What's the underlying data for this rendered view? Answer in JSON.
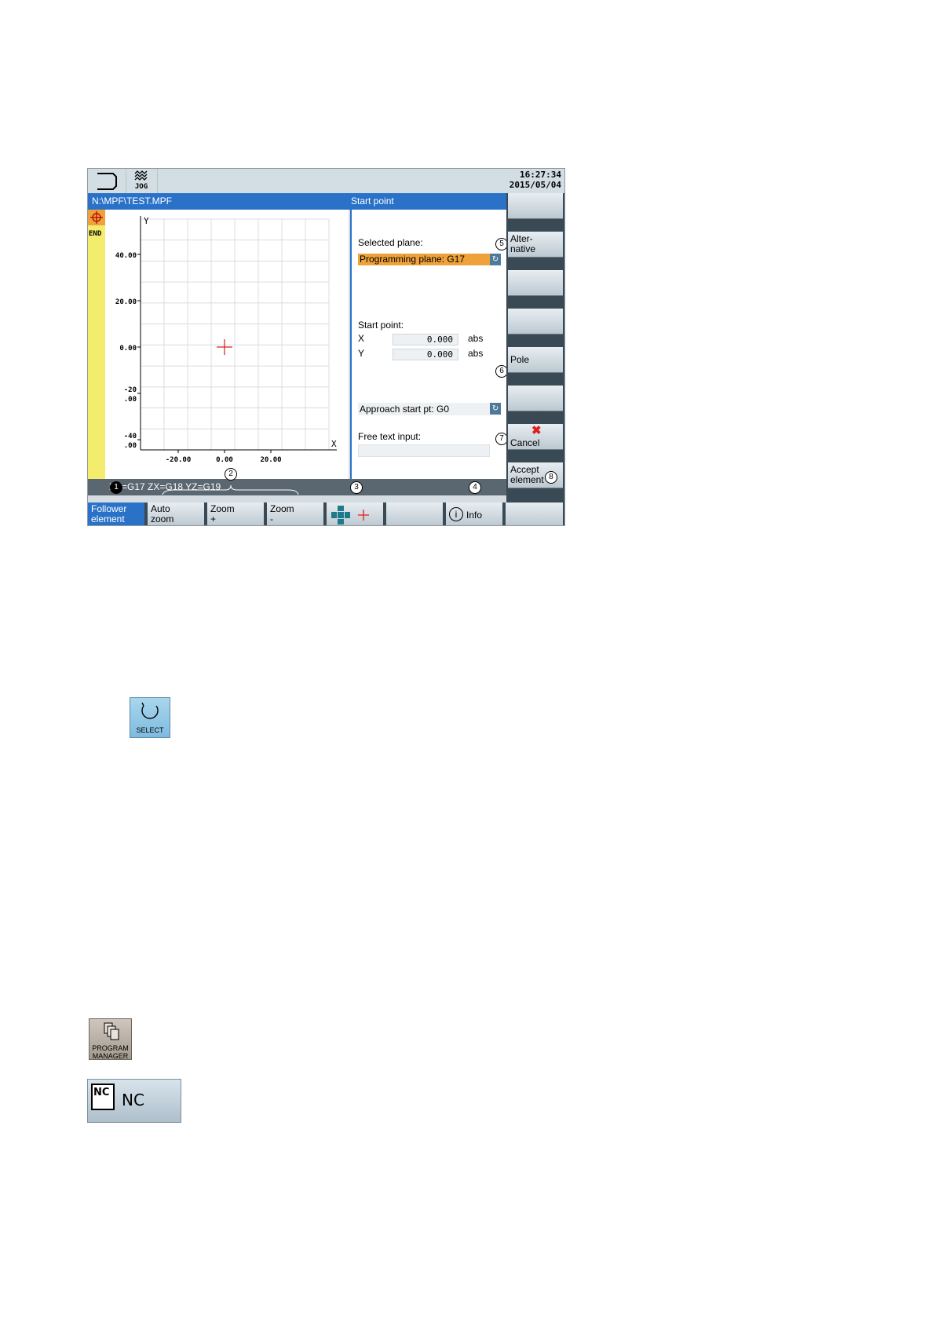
{
  "header": {
    "mode": "JOG",
    "time": "16:27:34",
    "date": "2015/05/04"
  },
  "title": {
    "path": "N:\\MPF\\TEST.MPF",
    "form_name": "Start point"
  },
  "left_strip": {
    "end_label": "END"
  },
  "graphic": {
    "y_axis_label": "Y",
    "x_axis_label": "X",
    "y_ticks": [
      "40.00",
      "20.00",
      "0.00",
      "-20\n.00",
      "-40\n.00"
    ],
    "x_ticks": [
      "-20.00",
      "0.00",
      "20.00"
    ],
    "start_marker": {
      "x": 0.0,
      "y": 0.0
    }
  },
  "form": {
    "selected_plane_label": "Selected plane:",
    "selected_plane_value": "Programming plane: G17",
    "start_point_label": "Start point:",
    "x_label": "X",
    "x_value": "0.000",
    "x_unit": "abs",
    "y_label": "Y",
    "y_value": "0.000",
    "y_unit": "abs",
    "approach_value": "Approach start pt: G0",
    "free_text_label": "Free text input:",
    "free_text_value": ""
  },
  "status": {
    "plane_hint": "XY=G17 ZX=G18 YZ=G19"
  },
  "vertical_softkeys": [
    {
      "label": ""
    },
    {
      "label": "Alter-\nnative"
    },
    {
      "label": ""
    },
    {
      "label": ""
    },
    {
      "label": "Pole"
    },
    {
      "label": ""
    },
    {
      "label": "Cancel"
    },
    {
      "label": "Accept\nelement"
    }
  ],
  "horizontal_softkeys": [
    {
      "label": "Follower\nelement"
    },
    {
      "label": "Auto\nzoom"
    },
    {
      "label": "Zoom\n+"
    },
    {
      "label": "Zoom\n-"
    },
    {
      "label": ""
    },
    {
      "label": ""
    },
    {
      "label": "Info"
    },
    {
      "label": ""
    }
  ],
  "callouts": [
    "1",
    "2",
    "3",
    "4",
    "5",
    "6",
    "7",
    "8"
  ],
  "keys": {
    "select": "SELECT",
    "program_manager": "PROGRAM\nMANAGER",
    "nc": "NC",
    "nc_icon": "NC"
  },
  "colors": {
    "accent": "#2a72c8",
    "highlight": "#f0a23a",
    "strip": "#f4ec6d",
    "cancel": "#e02020"
  }
}
